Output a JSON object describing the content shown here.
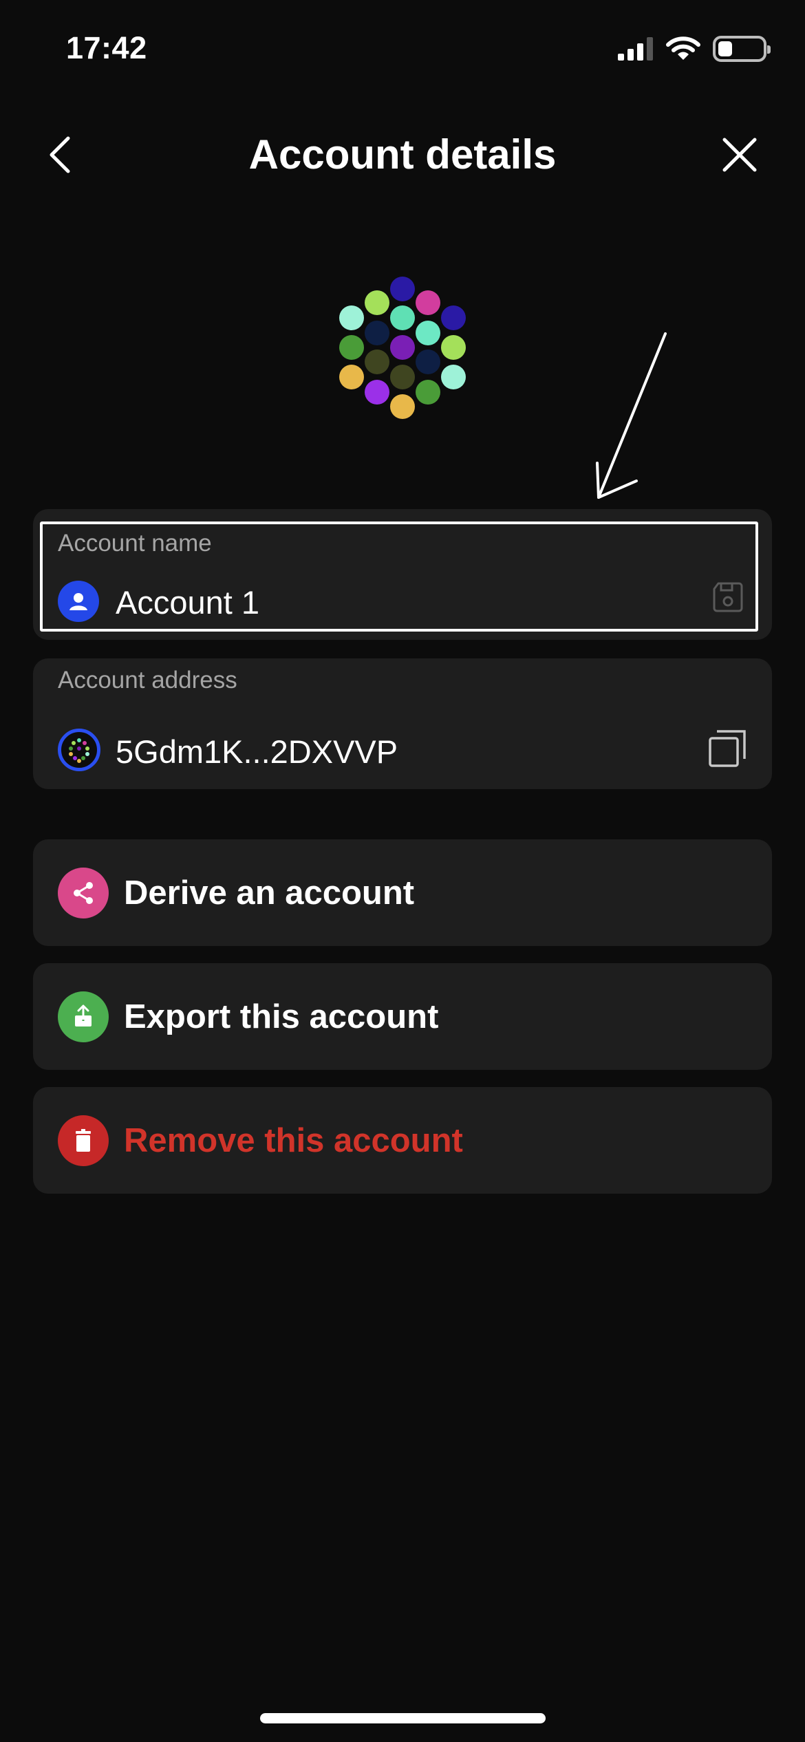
{
  "status_bar": {
    "time": "17:42"
  },
  "header": {
    "title": "Account details"
  },
  "account_name": {
    "label": "Account name",
    "value": "Account 1"
  },
  "account_address": {
    "label": "Account address",
    "value": "5Gdm1K...2DXVVP"
  },
  "actions": [
    {
      "label": "Derive an account",
      "icon": "share-icon",
      "color": "#d9488a"
    },
    {
      "label": "Export this account",
      "icon": "export-icon",
      "color": "#4caf50"
    },
    {
      "label": "Remove this account",
      "icon": "trash-icon",
      "color": "#c62828"
    }
  ],
  "colors": {
    "background": "#0c0c0c",
    "card": "#1e1e1e",
    "danger_text": "#d1342a",
    "accent_blue": "#2448e8"
  }
}
